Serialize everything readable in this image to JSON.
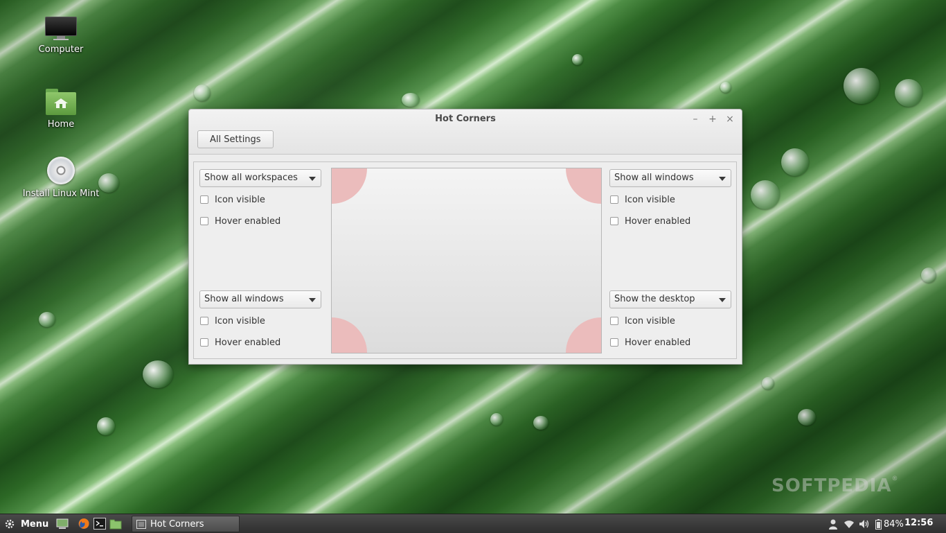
{
  "desktop": {
    "icons": [
      {
        "label": "Computer",
        "icon": "computer-monitor-icon"
      },
      {
        "label": "Home",
        "icon": "home-folder-icon"
      },
      {
        "label": "Install Linux Mint",
        "icon": "cd-disc-icon"
      }
    ],
    "watermark": "SOFTPEDIA",
    "watermark_mark": "®"
  },
  "window": {
    "title": "Hot Corners",
    "controls": {
      "minimize": "–",
      "maximize": "+",
      "close": "×"
    },
    "all_settings_label": "All Settings",
    "corners": {
      "top_left": {
        "action": "Show all workspaces",
        "icon_visible_label": "Icon visible",
        "hover_enabled_label": "Hover enabled",
        "icon_visible": false,
        "hover_enabled": false
      },
      "top_right": {
        "action": "Show all windows",
        "icon_visible_label": "Icon visible",
        "hover_enabled_label": "Hover enabled",
        "icon_visible": false,
        "hover_enabled": false
      },
      "bottom_left": {
        "action": "Show all windows",
        "icon_visible_label": "Icon visible",
        "hover_enabled_label": "Hover enabled",
        "icon_visible": false,
        "hover_enabled": false
      },
      "bottom_right": {
        "action": "Show the desktop",
        "icon_visible_label": "Icon visible",
        "hover_enabled_label": "Hover enabled",
        "icon_visible": false,
        "hover_enabled": false
      }
    },
    "corner_highlight_color": "#ebbcbc"
  },
  "panel": {
    "menu_label": "Menu",
    "launchers": [
      "show-desktop-icon",
      "firefox-icon",
      "terminal-icon",
      "files-folder-icon"
    ],
    "task": {
      "label": "Hot Corners",
      "icon": "settings-window-icon"
    },
    "tray": {
      "icons": [
        "user-icon",
        "wifi-icon",
        "volume-icon",
        "battery-icon"
      ],
      "battery": "84%",
      "clock": "12:56"
    }
  }
}
